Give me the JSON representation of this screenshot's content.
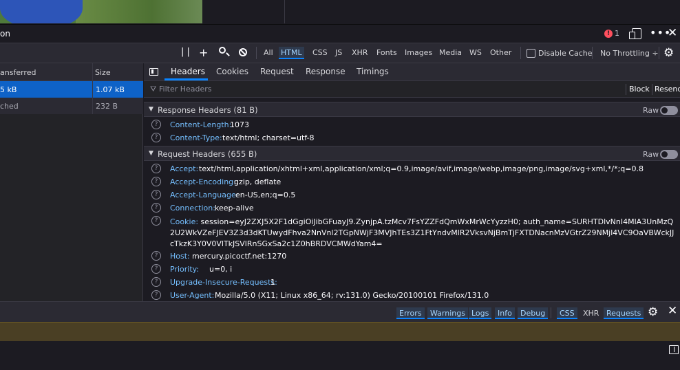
{
  "toolbox": {
    "title": "on",
    "error_count": "1",
    "error_badge": "!"
  },
  "net_toolbar": {
    "pause_glyph": "| |",
    "filters": [
      "All",
      "HTML",
      "CSS",
      "JS",
      "XHR",
      "Fonts",
      "Images",
      "Media",
      "WS",
      "Other"
    ],
    "selected_filter": "HTML",
    "disable_cache": "Disable Cache",
    "throttling": "No Throttling ÷"
  },
  "request_list": {
    "columns": [
      "ansferred",
      "Size"
    ],
    "rows": [
      {
        "transferred": "5 kB",
        "size": "1.07 kB",
        "selected": true
      },
      {
        "transferred": "ched",
        "size": "232 B",
        "selected": false
      }
    ]
  },
  "details": {
    "tabs": [
      "Headers",
      "Cookies",
      "Request",
      "Response",
      "Timings"
    ],
    "selected_tab": "Headers",
    "filter_placeholder": "Filter Headers",
    "block_label": "Block",
    "resend_label": "Resend",
    "raw_label": "Raw",
    "response_section": "Response Headers (81 B)",
    "response_headers": [
      {
        "name": "Content-Length:",
        "value": "1073"
      },
      {
        "name": "Content-Type:",
        "value": "text/html; charset=utf-8"
      }
    ],
    "request_section": "Request Headers (655 B)",
    "request_headers": [
      {
        "name": "Accept:",
        "value": "text/html,application/xhtml+xml,application/xml;q=0.9,image/avif,image/webp,image/png,image/svg+xml,*/*;q=0.8"
      },
      {
        "name": "Accept-Encoding:",
        "value": "gzip, deflate"
      },
      {
        "name": "Accept-Language:",
        "value": "en-US,en;q=0.5"
      },
      {
        "name": "Connection:",
        "value": "keep-alive"
      },
      {
        "name": "Cookie:",
        "value": "session=eyJ2ZXJ5X2F1dGgiOiJibGFuayJ9.ZynjpA.tzMcv7FsYZZFdQmWxMrWcYyzzH0; auth_name=SURHTDlvNnI4MlA3UnMzQ2U2WkVZeFJEV3Z3d3dKTUwydFhva2NnVnl2TGpNWjF3MVJhTEs3Z1FtYndvMlR2VksvNjBmTjFXTDNacnMzVGtrZ29NMjl4VC9OaVBWckJJcTkzK3Y0V0VlTkJSVlRnSGxSa2c1Z0hBRDVCMWdYam4="
      },
      {
        "name": "Host:",
        "value": "mercury.picoctf.net:1270"
      },
      {
        "name": "Priority:",
        "value": "u=0, i"
      },
      {
        "name": "Upgrade-Insecure-Requests:",
        "value": "1"
      },
      {
        "name": "User-Agent:",
        "value": "Mozilla/5.0 (X11; Linux x86_64; rv:131.0) Gecko/20100101 Firefox/131.0"
      }
    ]
  },
  "console_bar": {
    "buttons": [
      "Errors",
      "Warnings",
      "Logs",
      "Info",
      "Debug",
      "CSS",
      "XHR",
      "Requests"
    ]
  },
  "help_glyph": "?"
}
